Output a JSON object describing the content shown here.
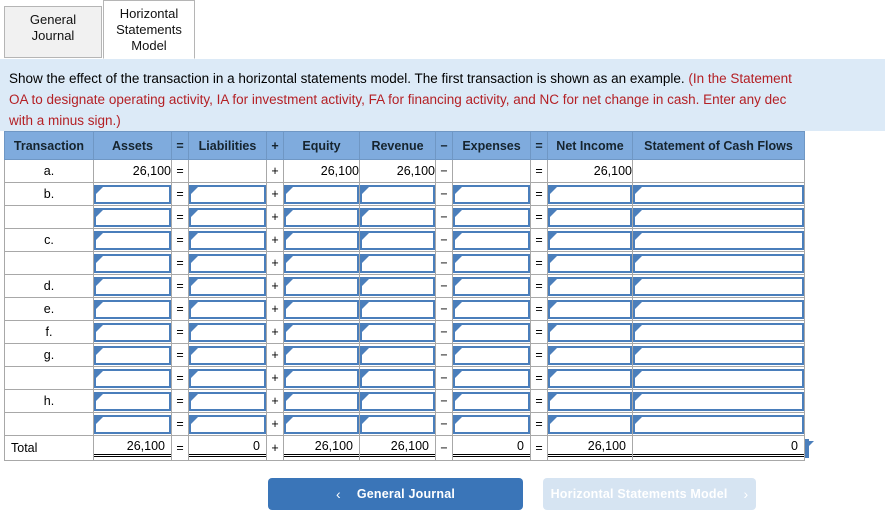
{
  "tabs": [
    {
      "label": "General\nJournal",
      "line1": "General",
      "line2": "Journal",
      "active": false
    },
    {
      "label": "Horizontal Statements Model",
      "line1": "Horizontal",
      "line2": "Statements",
      "line3": "Model",
      "active": true
    }
  ],
  "instructions": {
    "line1_black": "Show the effect of the transaction in a horizontal statements model. The first transaction is shown as an example. ",
    "line1_red": "(In the Statement",
    "line2_red": "OA to designate operating activity, IA for investment activity, FA for financing activity, and NC for net change in cash. Enter any dec",
    "line3_red": "with a minus sign.)"
  },
  "table": {
    "headers": [
      "Transaction",
      "Assets",
      "=",
      "Liabilities",
      "+",
      "Equity",
      "Revenue",
      "−",
      "Expenses",
      "=",
      "Net Income",
      "Statement of Cash Flows"
    ],
    "rows": [
      {
        "label": "a.",
        "type": "example",
        "assets": "26,100",
        "liabilities": "",
        "equity": "26,100",
        "revenue": "26,100",
        "expenses": "",
        "net_income": "",
        "cash_flows": "",
        "net_income_value": "26,100"
      },
      {
        "label": "b.",
        "type": "input"
      },
      {
        "label": "",
        "type": "input"
      },
      {
        "label": "c.",
        "type": "input"
      },
      {
        "label": "",
        "type": "input"
      },
      {
        "label": "d.",
        "type": "input"
      },
      {
        "label": "e.",
        "type": "input"
      },
      {
        "label": "f.",
        "type": "input"
      },
      {
        "label": "g.",
        "type": "input"
      },
      {
        "label": "",
        "type": "input"
      },
      {
        "label": "h.",
        "type": "input"
      },
      {
        "label": "",
        "type": "input"
      }
    ],
    "total": {
      "label": "Total",
      "assets": "26,100",
      "liabilities": "0",
      "equity": "26,100",
      "revenue": "26,100",
      "expenses": "0",
      "net_income": "26,100",
      "cash_flows": "0"
    },
    "operators": {
      "eq1": "=",
      "plus": "+",
      "minus": "−",
      "eq2": "="
    }
  },
  "footer": {
    "prev_label": "General Journal",
    "prev_chevron": "‹",
    "next_label": "Horizontal Statements Model",
    "next_chevron": "›"
  },
  "colors": {
    "header_blue": "#7fabdd",
    "banner_blue": "#dceaf7",
    "instruction_red": "#b42025",
    "input_border": "#4a7ebb",
    "button_blue": "#3a75b8",
    "button_disabled": "#d6e4f2"
  }
}
